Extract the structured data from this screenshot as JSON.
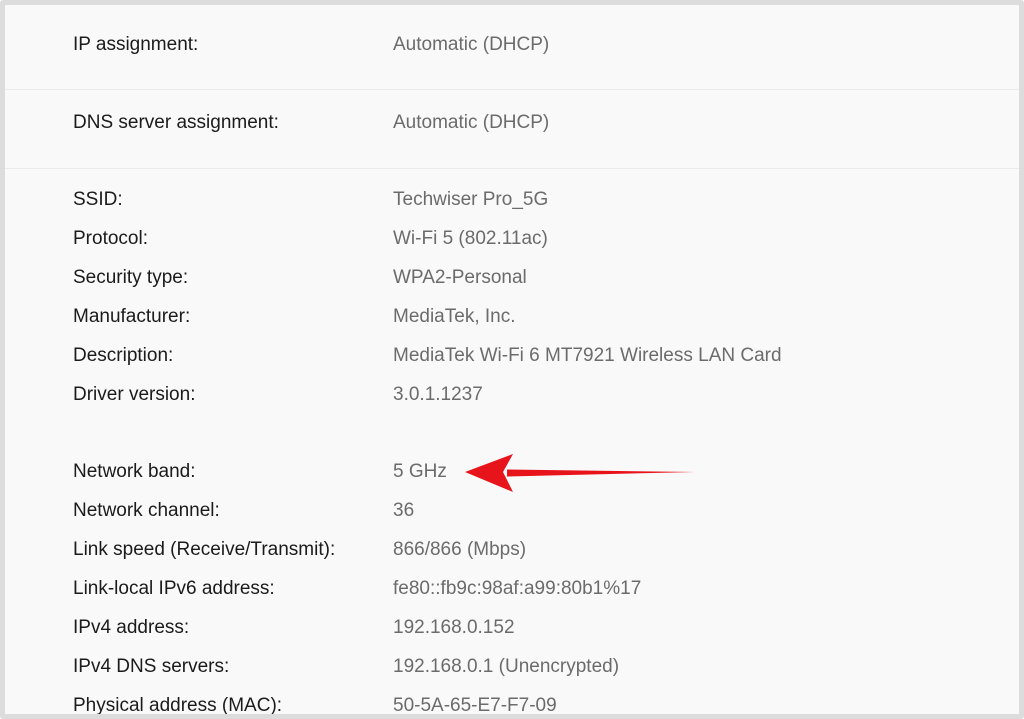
{
  "ip_section": {
    "label": "IP assignment:",
    "value": "Automatic (DHCP)"
  },
  "dns_section": {
    "label": "DNS server assignment:",
    "value": "Automatic (DHCP)"
  },
  "details": {
    "ssid": {
      "label": "SSID:",
      "value": "Techwiser Pro_5G"
    },
    "protocol": {
      "label": "Protocol:",
      "value": "Wi-Fi 5 (802.11ac)"
    },
    "security_type": {
      "label": "Security type:",
      "value": "WPA2-Personal"
    },
    "manufacturer": {
      "label": "Manufacturer:",
      "value": "MediaTek, Inc."
    },
    "description": {
      "label": "Description:",
      "value": "MediaTek Wi-Fi 6 MT7921 Wireless LAN Card"
    },
    "driver_version": {
      "label": "Driver version:",
      "value": "3.0.1.1237"
    },
    "network_band": {
      "label": "Network band:",
      "value": "5 GHz"
    },
    "network_channel": {
      "label": "Network channel:",
      "value": "36"
    },
    "link_speed": {
      "label": "Link speed (Receive/Transmit):",
      "value": "866/866 (Mbps)"
    },
    "link_local_ipv6": {
      "label": "Link-local IPv6 address:",
      "value": "fe80::fb9c:98af:a99:80b1%17"
    },
    "ipv4_address": {
      "label": "IPv4 address:",
      "value": "192.168.0.152"
    },
    "ipv4_dns": {
      "label": "IPv4 DNS servers:",
      "value": "192.168.0.1 (Unencrypted)"
    },
    "mac": {
      "label": "Physical address (MAC):",
      "value": "50-5A-65-E7-F7-09"
    }
  },
  "annotation": {
    "arrow_color": "#e8141b",
    "icon": "red-arrow-pointing-left"
  }
}
